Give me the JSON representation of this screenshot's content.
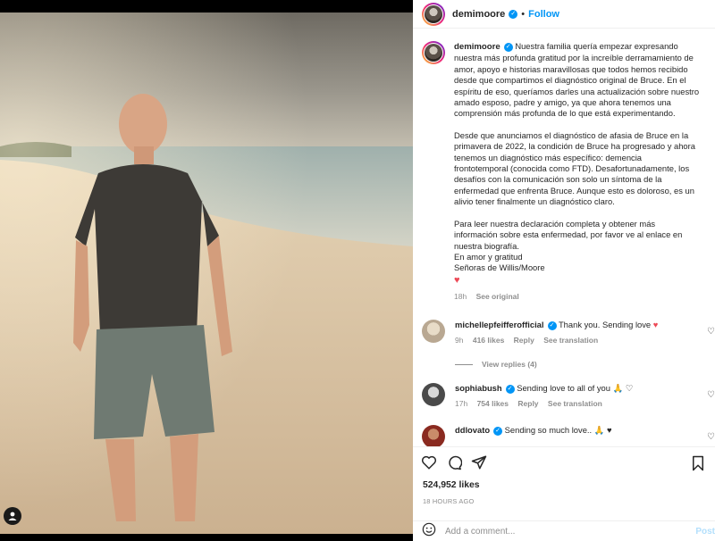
{
  "post": {
    "author": "demimoore",
    "follow_label": "Follow",
    "separator": "•",
    "caption": {
      "paragraph1": [
        "Nuestra familia quería empezar expresando",
        "nuestra más profunda gratitud por la increíble derramamiento de",
        "amor, apoyo e historias maravillosas que todos hemos recibido",
        "desde que compartimos el diagnóstico original de Bruce. En el",
        "espíritu de eso, queríamos darles una actualización sobre nuestro",
        "amado esposo, padre y amigo, ya que ahora tenemos una",
        "comprensión más profunda de lo que está experimentando."
      ],
      "paragraph2": [
        "Desde que anunciamos el diagnóstico de afasia de Bruce en la",
        "primavera de 2022, la condición de Bruce ha progresado y ahora",
        "tenemos un diagnóstico más específico: demencia",
        "frontotemporal (conocida como FTD). Desafortunadamente, los",
        "desafíos con la comunicación son solo un síntoma de la",
        "enfermedad que enfrenta Bruce. Aunque esto es doloroso, es un",
        "alivio tener finalmente un diagnóstico claro."
      ],
      "paragraph3": [
        "Para leer nuestra declaración completa y obtener más",
        "información sobre esta enfermedad, por favor ve al enlace en",
        "nuestra biografía.",
        "En amor y gratitud",
        "Señoras de Willis/Moore"
      ],
      "heart": "♥",
      "time": "18h",
      "see_original": "See original"
    },
    "comments": [
      {
        "user": "michellepfeifferofficial",
        "text": "Thank you. Sending love",
        "emoji": "♥",
        "time": "9h",
        "likes": "416 likes",
        "reply": "Reply",
        "translate": "See translation"
      },
      {
        "user": "sophiabush",
        "text": "Sending love to all of you",
        "emoji": "🙏 ♡",
        "time": "17h",
        "likes": "754 likes",
        "reply": "Reply",
        "translate": "See translation"
      },
      {
        "user": "ddlovato",
        "text": "Sending so much love..",
        "emoji": "🙏 ♥",
        "time": "",
        "likes": "",
        "reply": "",
        "translate": ""
      }
    ],
    "view_replies": "View replies (4)",
    "likes_count": "524,952 likes",
    "posted_ago": "18 HOURS AGO",
    "add_comment_placeholder": "Add a comment...",
    "post_label": "Post",
    "icons": [
      "heart-outline-icon",
      "comment-icon",
      "share-icon",
      "bookmark-icon",
      "emoji-icon",
      "user-tag-icon"
    ]
  }
}
